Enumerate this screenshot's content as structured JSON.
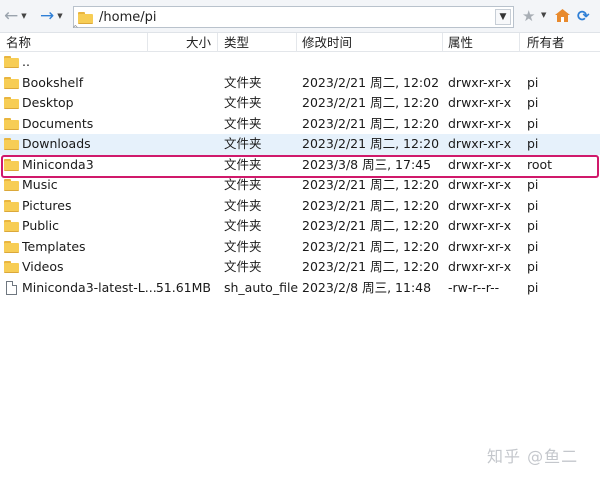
{
  "toolbar": {
    "path": "/home/pi"
  },
  "header": {
    "name": "名称",
    "size": "大小",
    "type": "类型",
    "modified": "修改时间",
    "attributes": "属性",
    "owner": "所有者"
  },
  "rows": [
    {
      "icon": "folder-icon",
      "name": "..",
      "size": "",
      "type": "",
      "modified": "",
      "perm": "",
      "owner": ""
    },
    {
      "icon": "folder-icon",
      "name": "Bookshelf",
      "size": "",
      "type": "文件夹",
      "modified": "2023/2/21 周二, 12:02",
      "perm": "drwxr-xr-x",
      "owner": "pi"
    },
    {
      "icon": "folder-icon",
      "name": "Desktop",
      "size": "",
      "type": "文件夹",
      "modified": "2023/2/21 周二, 12:20",
      "perm": "drwxr-xr-x",
      "owner": "pi"
    },
    {
      "icon": "folder-icon",
      "name": "Documents",
      "size": "",
      "type": "文件夹",
      "modified": "2023/2/21 周二, 12:20",
      "perm": "drwxr-xr-x",
      "owner": "pi"
    },
    {
      "icon": "folder-icon",
      "name": "Downloads",
      "size": "",
      "type": "文件夹",
      "modified": "2023/2/21 周二, 12:20",
      "perm": "drwxr-xr-x",
      "owner": "pi"
    },
    {
      "icon": "folder-icon",
      "name": "Miniconda3",
      "size": "",
      "type": "文件夹",
      "modified": "2023/3/8 周三, 17:45",
      "perm": "drwxr-xr-x",
      "owner": "root"
    },
    {
      "icon": "folder-icon",
      "name": "Music",
      "size": "",
      "type": "文件夹",
      "modified": "2023/2/21 周二, 12:20",
      "perm": "drwxr-xr-x",
      "owner": "pi"
    },
    {
      "icon": "folder-icon",
      "name": "Pictures",
      "size": "",
      "type": "文件夹",
      "modified": "2023/2/21 周二, 12:20",
      "perm": "drwxr-xr-x",
      "owner": "pi"
    },
    {
      "icon": "folder-icon",
      "name": "Public",
      "size": "",
      "type": "文件夹",
      "modified": "2023/2/21 周二, 12:20",
      "perm": "drwxr-xr-x",
      "owner": "pi"
    },
    {
      "icon": "folder-icon",
      "name": "Templates",
      "size": "",
      "type": "文件夹",
      "modified": "2023/2/21 周二, 12:20",
      "perm": "drwxr-xr-x",
      "owner": "pi"
    },
    {
      "icon": "folder-icon",
      "name": "Videos",
      "size": "",
      "type": "文件夹",
      "modified": "2023/2/21 周二, 12:20",
      "perm": "drwxr-xr-x",
      "owner": "pi"
    },
    {
      "icon": "file-icon",
      "name": "Miniconda3-latest-L...",
      "size": "51.61MB",
      "type": "sh_auto_file",
      "modified": "2023/2/8 周三, 11:48",
      "perm": "-rw-r--r--",
      "owner": "pi"
    }
  ],
  "watermark": "知乎 @鱼二",
  "colors": {
    "highlight_border": "#d0196b",
    "selected_row": "#e6f1fb",
    "folder": "#f7cd55"
  }
}
